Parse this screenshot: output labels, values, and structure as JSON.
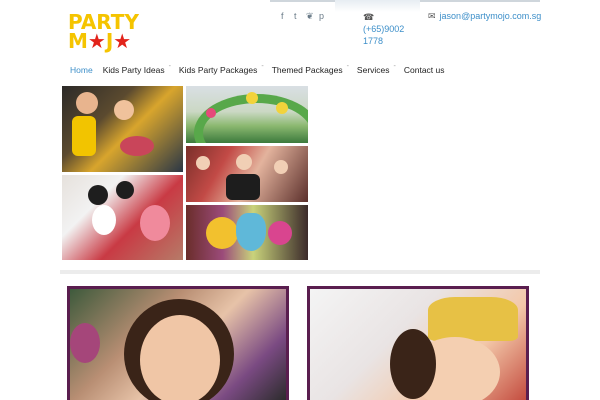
{
  "logo": {
    "line1": "PARTY",
    "line2_a": "M",
    "line2_star": "★",
    "line2_b": "J",
    "line2_c": "O",
    "alt": "Party Mojo"
  },
  "social": [
    {
      "name": "facebook-icon",
      "glyph": "f"
    },
    {
      "name": "tumblr-icon",
      "glyph": "t"
    },
    {
      "name": "twitter-icon",
      "glyph": "❦"
    },
    {
      "name": "pinterest-icon",
      "glyph": "p"
    }
  ],
  "contact": {
    "phone_icon": "☎",
    "phone": "(+65)9002 1778",
    "email_icon": "✉",
    "email": "jason@partymojo.com.sg"
  },
  "nav": [
    {
      "label": "Home",
      "active": true,
      "dropdown": false
    },
    {
      "label": "Kids Party Ideas",
      "dropdown": true
    },
    {
      "label": "Kids Party Packages",
      "dropdown": true
    },
    {
      "label": "Themed Packages",
      "dropdown": true
    },
    {
      "label": "Services",
      "dropdown": true
    },
    {
      "label": "Contact us",
      "dropdown": false
    }
  ],
  "nav_caret": "-",
  "colors": {
    "link": "#3d8fc9",
    "logo_yellow": "#f5c400",
    "logo_red": "#e2231a",
    "card_border": "#5a1e4f"
  }
}
